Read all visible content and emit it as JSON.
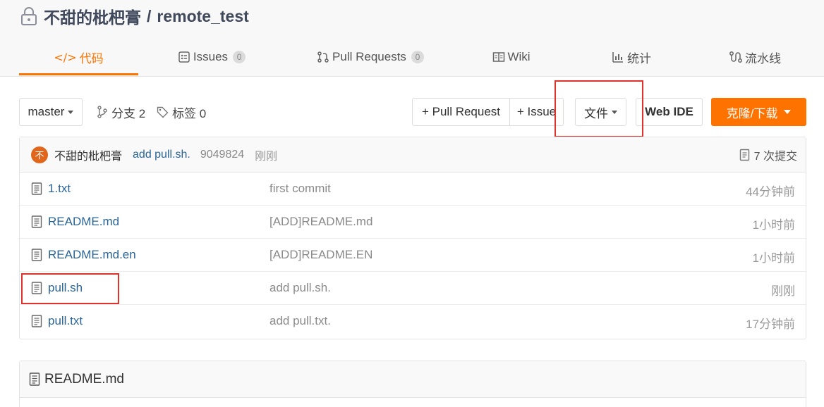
{
  "repo": {
    "owner": "不甜的枇杷膏",
    "separator": "/",
    "name": "remote_test",
    "lock_icon": "lock-icon"
  },
  "tabs": [
    {
      "label": "代码",
      "icon": "code-icon",
      "active": true
    },
    {
      "label": "Issues",
      "icon": "issues-icon",
      "count": "0"
    },
    {
      "label": "Pull Requests",
      "icon": "pull-request-icon",
      "count": "0"
    },
    {
      "label": "Wiki",
      "icon": "wiki-icon"
    },
    {
      "label": "统计",
      "icon": "stats-icon"
    },
    {
      "label": "流水线",
      "icon": "pipeline-icon"
    }
  ],
  "toolbar": {
    "branch": "master",
    "branches_label": "分支 2",
    "tags_label": "标签 0",
    "pull_request_label": "+ Pull Request",
    "issue_label": "+ Issue",
    "file_label": "文件",
    "web_ide_label": "Web IDE",
    "clone_label": "克隆/下载"
  },
  "last_commit": {
    "avatar_text": "不",
    "author": "不甜的枇杷膏",
    "message": "add pull.sh.",
    "sha": "9049824",
    "time": "刚刚",
    "commits_label": "7 次提交"
  },
  "files": [
    {
      "name": "1.txt",
      "message": "first commit",
      "time": "44分钟前"
    },
    {
      "name": "README.md",
      "message": "[ADD]README.md",
      "time": "1小时前"
    },
    {
      "name": "README.md.en",
      "message": "[ADD]README.EN",
      "time": "1小时前"
    },
    {
      "name": "pull.sh",
      "message": "add pull.sh.",
      "time": "刚刚"
    },
    {
      "name": "pull.txt",
      "message": "add pull.txt.",
      "time": "17分钟前"
    }
  ],
  "readme": {
    "title": "README.md"
  },
  "colors": {
    "accent": "#fe7300",
    "link": "#2a6496",
    "highlight": "#e0322b"
  }
}
